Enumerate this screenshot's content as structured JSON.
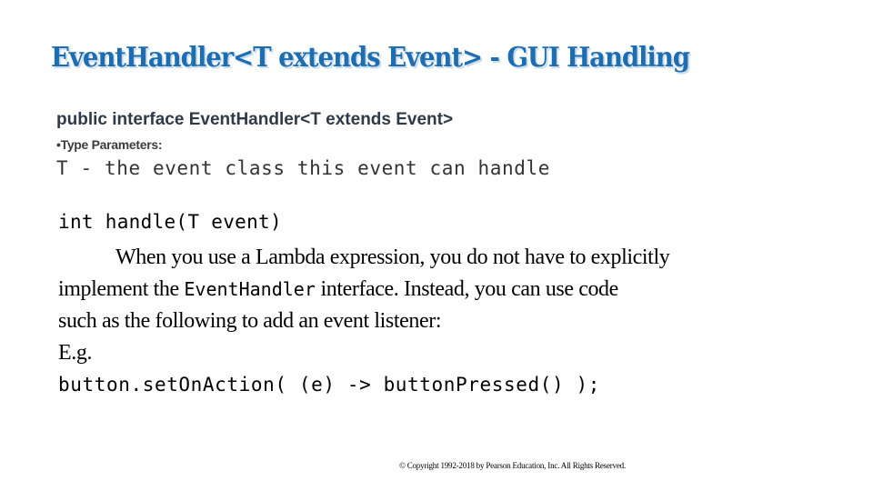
{
  "slide": {
    "title": "EventHandler<T extends Event> - GUI Handling",
    "interface_declaration": "public interface EventHandler<T extends Event>",
    "type_parameters_label": "•Type Parameters:",
    "type_parameter_description": "T - the event class this event can handle",
    "method_signature": "int handle(T event)",
    "paragraph": {
      "line1": "When you use a Lambda expression, you do not have to explicitly",
      "line2_before": "implement the ",
      "line2_code": "EventHandler",
      "line2_after": " interface. Instead, you can use code",
      "line3": "such as the following to add an event listener:",
      "example_label": "E.g.",
      "example_code": "button.setOnAction( (e) -> buttonPressed() );"
    },
    "copyright": "© Copyright 1992-2018 by Pearson Education, Inc. All Rights Reserved."
  },
  "colors": {
    "title": "#1f6db1",
    "title_shadow": "#c5d9ee",
    "interface_text": "#2e3a48",
    "body_text": "#000000"
  }
}
